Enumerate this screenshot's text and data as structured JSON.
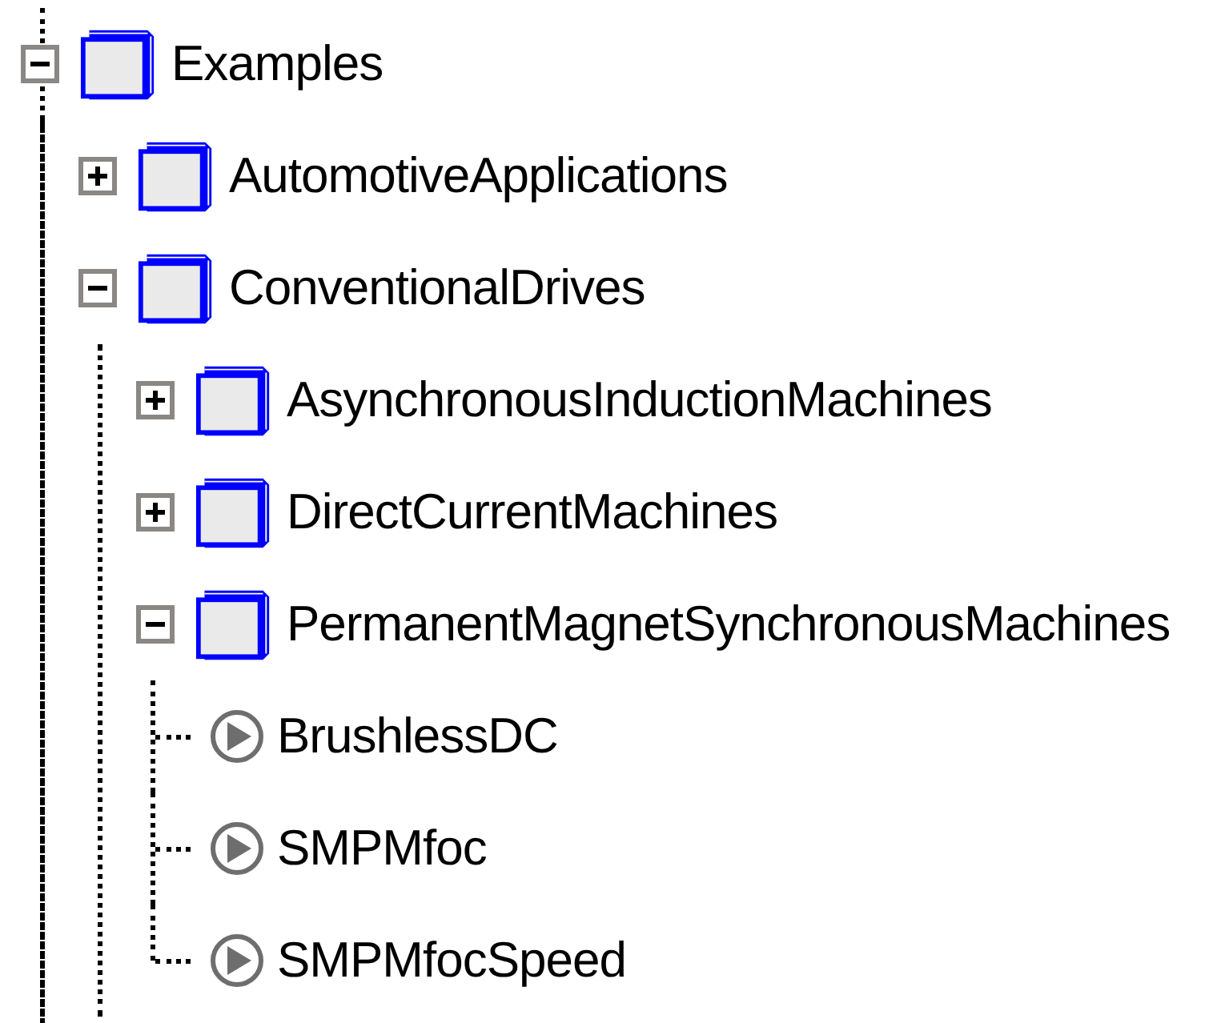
{
  "tree": [
    {
      "label": "Examples",
      "kind": "folder",
      "expanded": true,
      "children": [
        {
          "label": "AutomotiveApplications",
          "kind": "folder",
          "expanded": false
        },
        {
          "label": "ConventionalDrives",
          "kind": "folder",
          "expanded": true,
          "children": [
            {
              "label": "AsynchronousInductionMachines",
              "kind": "folder",
              "expanded": false
            },
            {
              "label": "DirectCurrentMachines",
              "kind": "folder",
              "expanded": false
            },
            {
              "label": "PermanentMagnetSynchronousMachines",
              "kind": "folder",
              "expanded": true,
              "children": [
                {
                  "label": "BrushlessDC",
                  "kind": "model"
                },
                {
                  "label": "SMPMfoc",
                  "kind": "model"
                },
                {
                  "label": "SMPMfocSpeed",
                  "kind": "model"
                }
              ]
            }
          ]
        }
      ]
    }
  ]
}
